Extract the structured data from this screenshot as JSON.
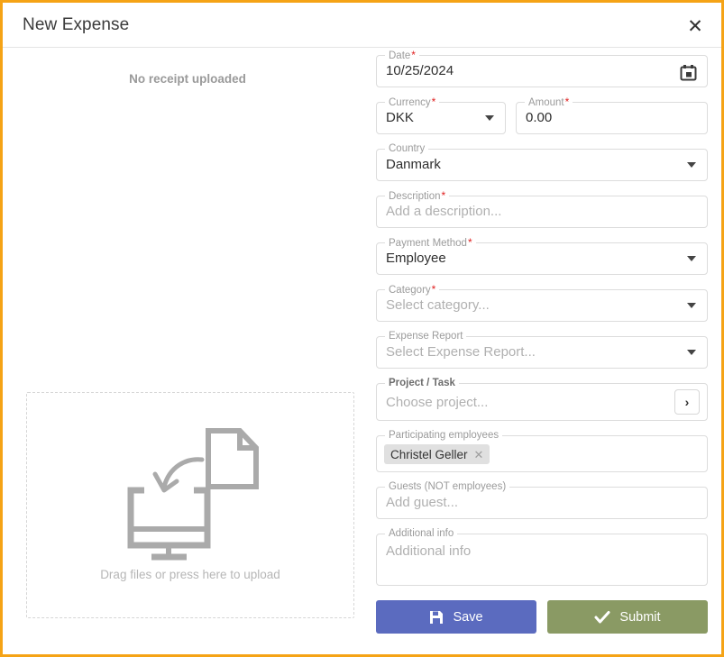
{
  "window": {
    "title": "New Expense",
    "close_label": "✕",
    "border_color": "#f5a316"
  },
  "receipt": {
    "status_text": "No receipt uploaded",
    "dropzone_text": "Drag files or press here to upload",
    "icon_name": "upload-monitor-document-icon"
  },
  "form": {
    "date": {
      "label": "Date",
      "required": true,
      "value": "10/25/2024",
      "icon": "calendar-icon"
    },
    "currency": {
      "label": "Currency",
      "required": true,
      "value": "DKK"
    },
    "amount": {
      "label": "Amount",
      "required": true,
      "value": "0.00"
    },
    "country": {
      "label": "Country",
      "required": false,
      "value": "Danmark"
    },
    "description": {
      "label": "Description",
      "required": true,
      "value": "",
      "placeholder": "Add a description..."
    },
    "payment_method": {
      "label": "Payment Method",
      "required": true,
      "value": "Employee"
    },
    "category": {
      "label": "Category",
      "required": true,
      "value": "",
      "placeholder": "Select category..."
    },
    "expense_report": {
      "label": "Expense Report",
      "required": false,
      "value": "",
      "placeholder": "Select Expense Report..."
    },
    "project_task": {
      "label": "Project / Task",
      "required": false,
      "value": "",
      "placeholder": "Choose project...",
      "browse_icon": "chevron-right-icon"
    },
    "participating_employees": {
      "label": "Participating employees",
      "required": false,
      "chips": [
        {
          "name": "Christel Geller",
          "remove_label": "✕"
        }
      ]
    },
    "guests": {
      "label": "Guests (NOT employees)",
      "required": false,
      "value": "",
      "placeholder": "Add guest..."
    },
    "additional_info": {
      "label": "Additional info",
      "required": false,
      "value": "",
      "placeholder": "Additional info"
    }
  },
  "actions": {
    "save": {
      "label": "Save",
      "icon": "save-floppy-icon",
      "color": "#5b6bbf"
    },
    "submit": {
      "label": "Submit",
      "icon": "check-icon",
      "color": "#8a9a64"
    }
  }
}
